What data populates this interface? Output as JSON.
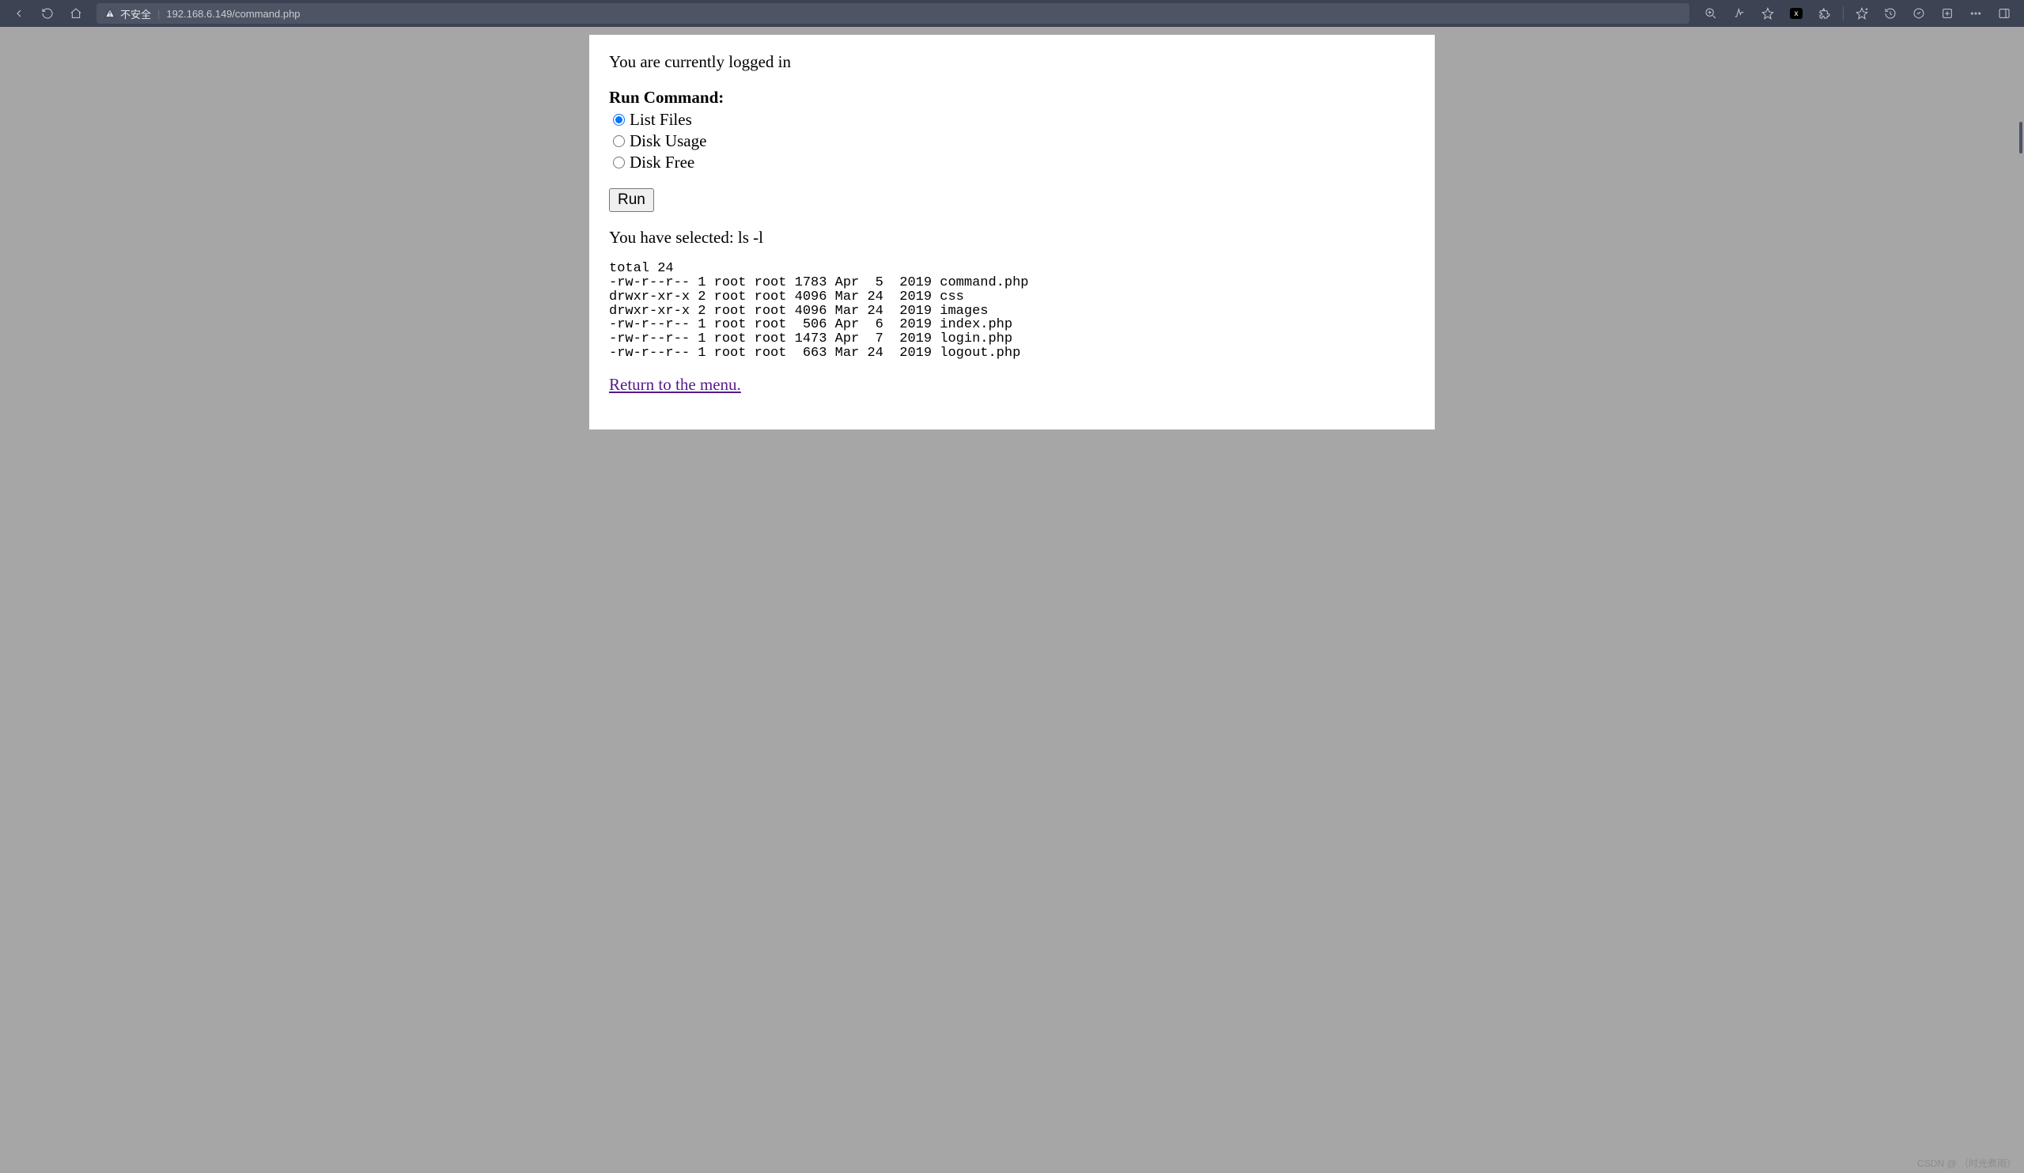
{
  "browser": {
    "security_label": "不安全",
    "url": "192.168.6.149/command.php",
    "badge_text": "x"
  },
  "page": {
    "logged_in_text": "You are currently logged in",
    "run_command_heading": "Run Command:",
    "options": {
      "list_files": "List Files",
      "disk_usage": "Disk Usage",
      "disk_free": "Disk Free"
    },
    "run_button": "Run",
    "selected_prefix": "You have selected: ",
    "selected_command": "ls -l",
    "output": "total 24\n-rw-r--r-- 1 root root 1783 Apr  5  2019 command.php\ndrwxr-xr-x 2 root root 4096 Mar 24  2019 css\ndrwxr-xr-x 2 root root 4096 Mar 24  2019 images\n-rw-r--r-- 1 root root  506 Apr  6  2019 index.php\n-rw-r--r-- 1 root root 1473 Apr  7  2019 login.php\n-rw-r--r-- 1 root root  663 Mar 24  2019 logout.php",
    "return_link": "Return to the menu."
  },
  "watermark": "CSDN @ （时光煮雨）"
}
